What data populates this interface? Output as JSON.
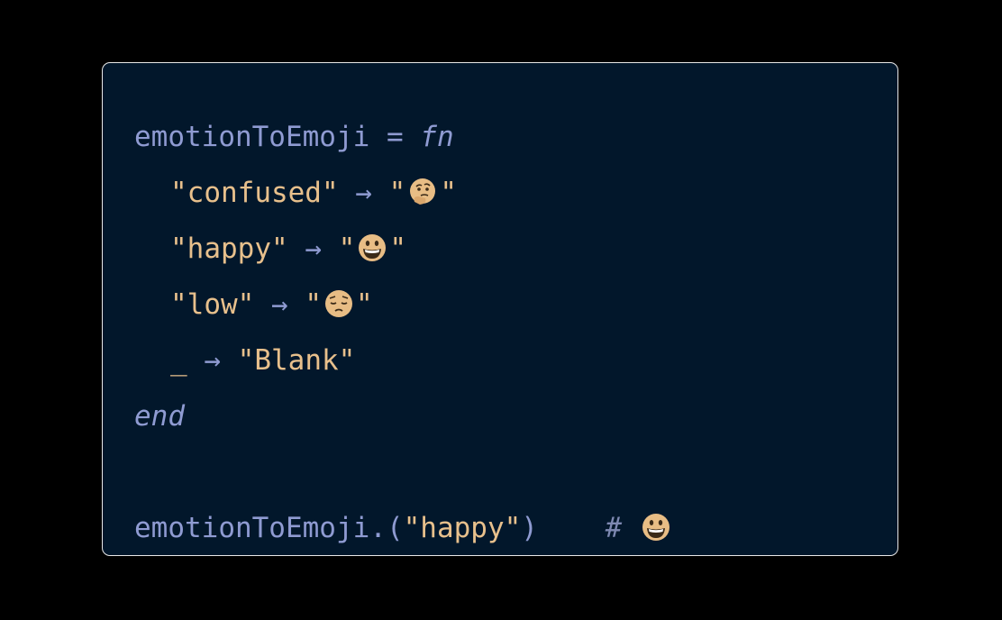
{
  "code": {
    "line1": {
      "name": "emotionToEmoji",
      "assign": " = ",
      "keyword": "fn"
    },
    "line2": {
      "pattern": "\"confused\"",
      "arrow": " → ",
      "quote_open": "\"",
      "quote_close": "\"",
      "emoji": "thinking-face-icon"
    },
    "line3": {
      "pattern": "\"happy\"",
      "arrow": " → ",
      "quote_open": "\"",
      "quote_close": "\"",
      "emoji": "grinning-face-icon"
    },
    "line4": {
      "pattern": "\"low\"",
      "arrow": " → ",
      "quote_open": "\"",
      "quote_close": "\"",
      "emoji": "pensive-face-icon"
    },
    "line5": {
      "pattern": "_",
      "arrow": " → ",
      "result": "\"Blank\""
    },
    "line6": {
      "keyword": "end"
    },
    "line7": {
      "call": "emotionToEmoji.(",
      "arg": "\"happy\"",
      "close": ")",
      "comment_mark": "#",
      "emoji": "grinning-face-icon"
    }
  },
  "colors": {
    "background": "#000000",
    "panel": "#02172b",
    "identifier": "#8f9bd2",
    "string": "#e8c08c",
    "emoji_fill": "#e8bd85"
  }
}
